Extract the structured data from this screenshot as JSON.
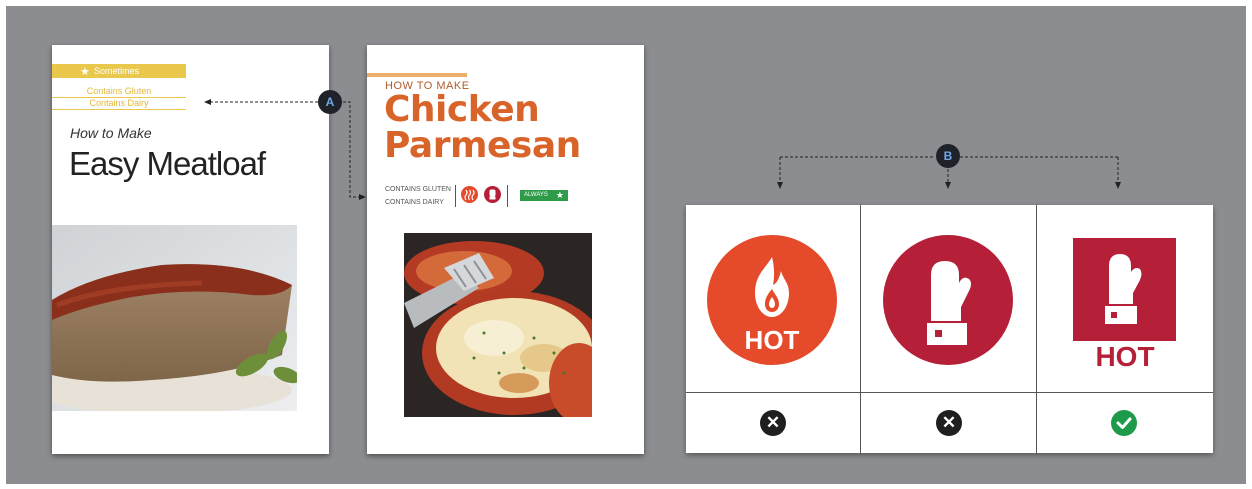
{
  "meatloaf_card": {
    "badge_label": "Sometimes",
    "allergen_1": "Contains Gluten",
    "allergen_2": "Contains Dairy",
    "subtitle": "How to Make",
    "title": "Easy Meatloaf"
  },
  "chicken_card": {
    "subtitle": "HOW TO MAKE",
    "title_line_1": "Chicken",
    "title_line_2": "Parmesan",
    "allergen_1": "CONTAINS GLUTEN",
    "allergen_2": "CONTAINS DAIRY",
    "badge_label": "ALWAYS"
  },
  "callouts": {
    "a": "A",
    "b": "B"
  },
  "icon_options": [
    {
      "icon": "fire-hot-circle-icon",
      "label": "HOT",
      "verdict": "reject",
      "color": "#e54a2a"
    },
    {
      "icon": "oven-mitt-circle-icon",
      "label": "",
      "verdict": "reject",
      "color": "#b51f38"
    },
    {
      "icon": "oven-mitt-square-icon",
      "label": "HOT",
      "verdict": "accept",
      "color": "#b51f38"
    }
  ],
  "colors": {
    "background": "#8c8d91",
    "accent_yellow": "#e9c84c",
    "accent_orange": "#d9642a",
    "hot_red": "#e54a2a",
    "mitt_red": "#b51f38",
    "check_green": "#1e9a4b"
  }
}
